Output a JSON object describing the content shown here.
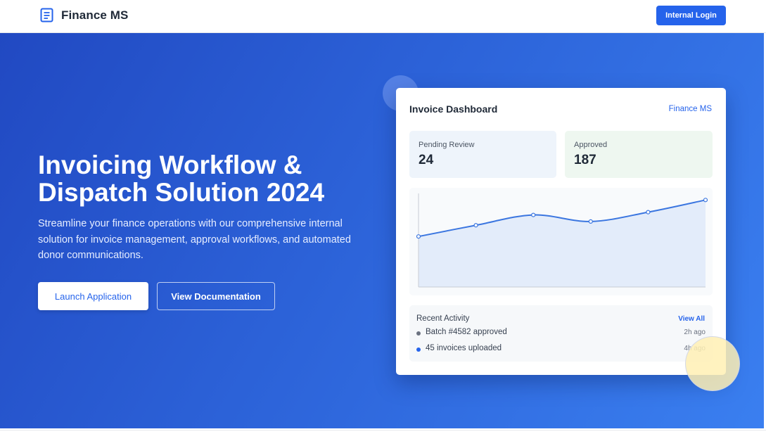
{
  "header": {
    "brand_name": "Finance MS",
    "brand_icon": "document-icon",
    "login_label": "Internal Login"
  },
  "hero": {
    "title_line1": "Invoicing Workflow &",
    "title_line2": "Dispatch Solution 2024",
    "subtitle": "Streamline your finance operations with our comprehensive internal solution for invoice management, approval workflows, and automated donor communications.",
    "primary_button": "Launch Application",
    "secondary_button": "View Documentation"
  },
  "dashboard": {
    "title": "Invoice Dashboard",
    "brand": "Finance MS",
    "stats": [
      {
        "label": "Pending Review",
        "value": "24"
      },
      {
        "label": "Approved",
        "value": "187"
      }
    ],
    "activity": {
      "title": "Recent Activity",
      "view_all": "View All",
      "items": [
        {
          "text": "Batch #4582 approved",
          "time": "2h ago",
          "dot_color": "#6b7280"
        },
        {
          "text": "45 invoices uploaded",
          "time": "4h ago",
          "dot_color": "#2563eb"
        }
      ]
    }
  },
  "chart_data": {
    "type": "area",
    "x": [
      1,
      2,
      3,
      4,
      5,
      6
    ],
    "values": [
      54,
      66,
      77,
      70,
      80,
      93
    ],
    "ylim": [
      0,
      100
    ],
    "line_color": "#3b76e0",
    "fill_color": "#e3ecfa",
    "grid": false
  },
  "colors": {
    "accent": "#2563eb",
    "hero_start": "#2149c2",
    "hero_end": "#3a7ff0"
  }
}
